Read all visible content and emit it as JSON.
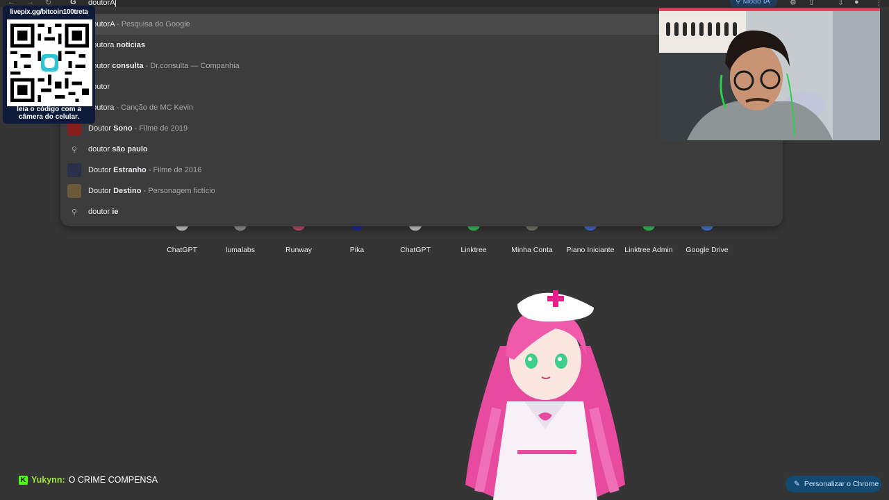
{
  "browser": {
    "omnibox_text": "doutorA",
    "modo_ia_label": "Modo IA",
    "icons": [
      "back-icon",
      "forward-icon",
      "reload-icon",
      "google-icon",
      "search-icon",
      "extensions-icon",
      "share-icon",
      "downloads-icon",
      "profile-icon",
      "menu-icon"
    ]
  },
  "suggestions": [
    {
      "prefix": "doutorA",
      "bold": "",
      "sub": " - Pesquisa do Google",
      "icon": "search-icon"
    },
    {
      "prefix": "doutora ",
      "bold": "noticias",
      "sub": "",
      "icon": "search-icon"
    },
    {
      "prefix": "doutor ",
      "bold": "consulta",
      "sub": " - Dr.consulta — Companhia",
      "icon": "search-icon"
    },
    {
      "prefix": "doutor",
      "bold": "",
      "sub": "",
      "icon": "search-icon"
    },
    {
      "prefix": "doutora",
      "bold": "",
      "sub": " - Canção de MC Kevin",
      "icon": "search-icon"
    },
    {
      "prefix": "Doutor ",
      "bold": "Sono",
      "sub": " - Filme de 2019",
      "icon": "movie-thumbnail"
    },
    {
      "prefix": "doutor ",
      "bold": "são paulo",
      "sub": "",
      "icon": "search-icon"
    },
    {
      "prefix": "Doutor ",
      "bold": "Estranho",
      "sub": " - Filme de 2016",
      "icon": "movie-thumbnail"
    },
    {
      "prefix": "Doutor ",
      "bold": "Destino",
      "sub": " - Personagem fictício",
      "icon": "character-thumbnail"
    },
    {
      "prefix": "doutor ",
      "bold": "ie",
      "sub": "",
      "icon": "search-icon"
    }
  ],
  "shortcuts": [
    {
      "label": "ChatGPT",
      "color": "#cfcfcf"
    },
    {
      "label": "lumalabs",
      "color": "#9a9a9a"
    },
    {
      "label": "Runway",
      "color": "#c0506b"
    },
    {
      "label": "Pika",
      "color": "#1b2a9a"
    },
    {
      "label": "ChatGPT",
      "color": "#cfcfcf"
    },
    {
      "label": "Linktree",
      "color": "#34c759"
    },
    {
      "label": "Minha Conta",
      "color": "#7a7a6a"
    },
    {
      "label": "Piano Iniciante",
      "color": "#4a6ad0"
    },
    {
      "label": "Linktree Admin",
      "color": "#34c759"
    },
    {
      "label": "Google Drive",
      "color": "#4a7ad8"
    }
  ],
  "qr_overlay": {
    "url": "livepix.gg/bitcoin100treta",
    "caption_line1": "leia o código com a",
    "caption_line2": "câmera do celular."
  },
  "chat": {
    "badge": "K",
    "username": "Yukynn",
    "separator": " :",
    "message": "O CRIME COMPENSA"
  },
  "customize_button": {
    "label": "Personalizar o Chrome",
    "icon": "pencil-icon"
  },
  "colors": {
    "background": "#353535",
    "dropdown": "#3c3c3c",
    "accent_blue": "#124a72",
    "webcam_border": "#e2455a"
  }
}
